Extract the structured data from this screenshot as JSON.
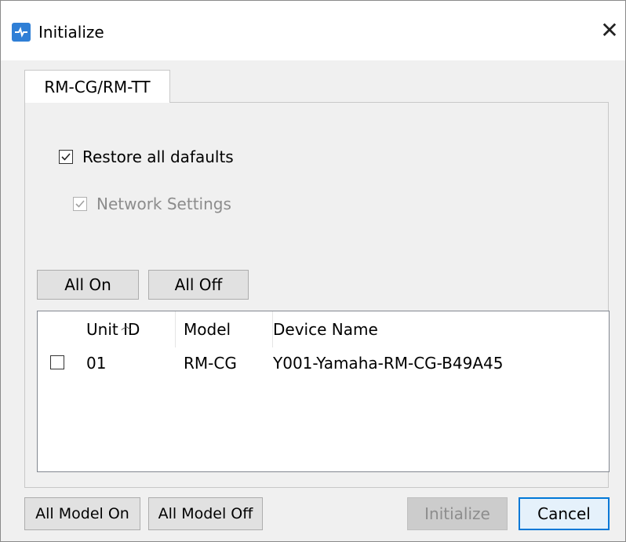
{
  "window": {
    "title": "Initialize",
    "close_icon": "close-icon",
    "accent": "#0078d7"
  },
  "tabs": [
    {
      "label": "RM-CG/RM-TT",
      "selected": true
    }
  ],
  "options": {
    "restore_all_defaults": {
      "label": "Restore all dafaults",
      "checked": true,
      "enabled": true
    },
    "network_settings": {
      "label": "Network Settings",
      "checked": true,
      "enabled": false
    }
  },
  "buttons": {
    "all_on": "All On",
    "all_off": "All Off",
    "all_model_on": "All Model On",
    "all_model_off": "All Model Off",
    "initialize": "Initialize",
    "cancel": "Cancel"
  },
  "device_list": {
    "columns": [
      "Unit ID",
      "Model",
      "Device Name"
    ],
    "sorted_column": "Unit ID",
    "rows": [
      {
        "checked": false,
        "unit_id": "01",
        "model": "RM-CG",
        "device_name": "Y001-Yamaha-RM-CG-B49A45"
      }
    ]
  }
}
